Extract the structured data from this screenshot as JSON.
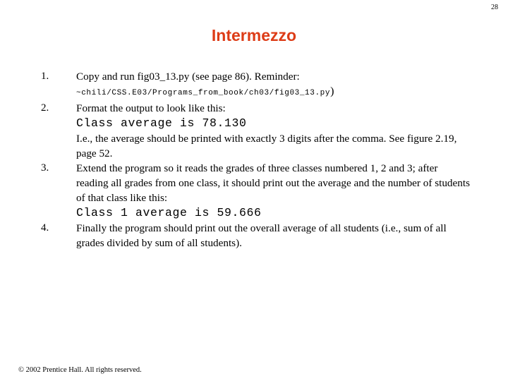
{
  "slide": {
    "page_number": "28",
    "title": "Intermezzo",
    "title_color": "#dd3c17",
    "background_color": "#ffffff",
    "text_color": "#000000"
  },
  "items": [
    {
      "number": "1.",
      "lines": [
        {
          "kind": "serif",
          "text": "Copy and run fig03_13.py (see page 86).  Reminder:"
        },
        {
          "kind": "path",
          "text": "~chili/CSS.E03/Programs_from_book/ch03/fig03_13.py",
          "trailing_paren": ")"
        }
      ]
    },
    {
      "number": "2.",
      "lines": [
        {
          "kind": "serif",
          "text": "Format the output to look like this:"
        },
        {
          "kind": "code",
          "text": "Class average is 78.130"
        },
        {
          "kind": "serif",
          "text": "I.e., the average should be printed with exactly 3 digits after the comma. See figure 2.19, page 52."
        }
      ]
    },
    {
      "number": "3.",
      "lines": [
        {
          "kind": "serif",
          "text": "Extend the program so it reads the grades of three classes numbered 1, 2 and 3; after reading all grades from one class, it should print out the average and the number of students of that class like this:"
        },
        {
          "kind": "code",
          "text": "Class 1 average is 59.666"
        }
      ]
    },
    {
      "number": "4.",
      "lines": [
        {
          "kind": "serif",
          "text": "Finally the program should print out the overall average of all students (i.e., sum of all grades divided by sum of all students)."
        }
      ]
    }
  ],
  "footer": {
    "copyright": "© 2002 Prentice Hall.  All rights reserved."
  }
}
